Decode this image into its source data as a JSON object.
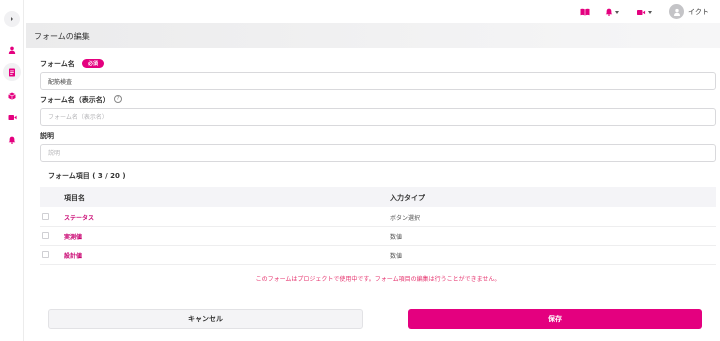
{
  "colors": {
    "accent": "#e4007f",
    "accent_text": "#c8006f",
    "notice": "#e6336e"
  },
  "sidebar": {
    "items": [
      {
        "icon": "chevron-right-icon"
      },
      {
        "icon": "user-icon"
      },
      {
        "icon": "document-icon",
        "active": true
      },
      {
        "icon": "cube-icon"
      },
      {
        "icon": "video-icon"
      },
      {
        "icon": "bell-icon"
      }
    ]
  },
  "topbar": {
    "items": [
      "book-icon",
      "bell-icon",
      "video-icon",
      "avatar"
    ],
    "user_name": "イクト"
  },
  "page": {
    "title": "フォームの編集"
  },
  "form": {
    "name_label": "フォーム名",
    "required_badge": "必須",
    "name_value": "配筋検査",
    "display_name_label": "フォーム名（表示名）",
    "display_name_placeholder": "フォーム名（表示名）",
    "description_label": "説明",
    "description_placeholder": "説明"
  },
  "items_section": {
    "title": "フォーム項目 ( 3 / 20 )",
    "columns": [
      "項目名",
      "入力タイプ"
    ],
    "rows": [
      {
        "name": "ステータス",
        "type": "ボタン選択"
      },
      {
        "name": "実測値",
        "type": "数値"
      },
      {
        "name": "設計値",
        "type": "数値"
      }
    ]
  },
  "notice": "このフォームはプロジェクトで使用中です。フォーム項目の編集は行うことができません。",
  "buttons": {
    "cancel": "キャンセル",
    "save": "保存"
  }
}
